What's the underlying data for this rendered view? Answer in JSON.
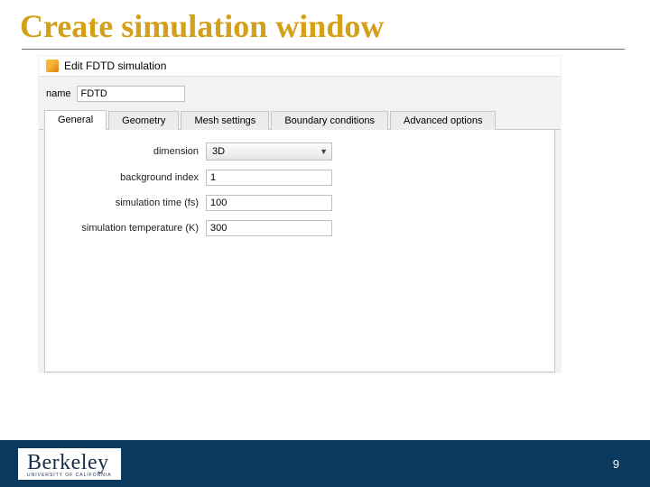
{
  "slide": {
    "title": "Create simulation window",
    "page_number": "9"
  },
  "window": {
    "title": "Edit FDTD simulation"
  },
  "name_field": {
    "label": "name",
    "value": "FDTD"
  },
  "tabs": {
    "t0": "General",
    "t1": "Geometry",
    "t2": "Mesh settings",
    "t3": "Boundary conditions",
    "t4": "Advanced options"
  },
  "general_panel": {
    "dimension_label": "dimension",
    "dimension_value": "3D",
    "bg_index_label": "background index",
    "bg_index_value": "1",
    "sim_time_label": "simulation time (fs)",
    "sim_time_value": "100",
    "sim_temp_label": "simulation temperature (K)",
    "sim_temp_value": "300"
  },
  "footer": {
    "logo_word": "Berkeley",
    "logo_sub": "UNIVERSITY OF CALIFORNIA"
  }
}
